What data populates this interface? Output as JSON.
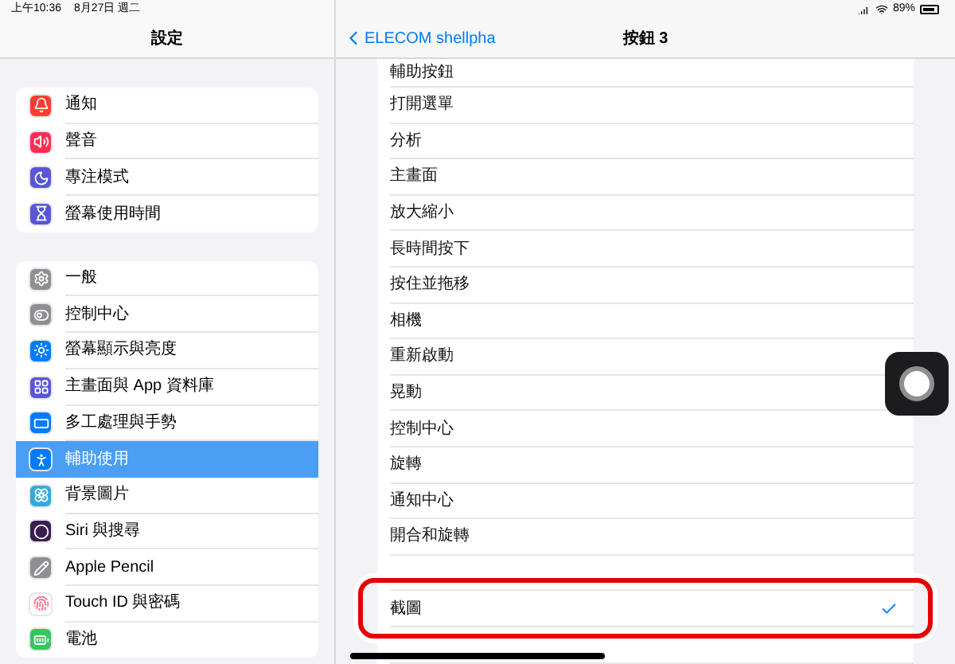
{
  "status_bar": {
    "time": "上午10:36",
    "date": "8月27日 週二",
    "battery": "89%"
  },
  "sidebar": {
    "title": "設定",
    "groups": [
      [
        {
          "label": "通知",
          "color": "#ff3b30",
          "selected": false
        },
        {
          "label": "聲音",
          "color": "#ff2d55",
          "selected": false
        },
        {
          "label": "專注模式",
          "color": "#5856d6",
          "selected": false
        },
        {
          "label": "螢幕使用時間",
          "color": "#5856d6",
          "selected": false
        }
      ],
      [
        {
          "label": "一般",
          "color": "#8e8e93",
          "selected": false
        },
        {
          "label": "控制中心",
          "color": "#8e8e93",
          "selected": false
        },
        {
          "label": "螢幕顯示與亮度",
          "color": "#007aff",
          "selected": false
        },
        {
          "label": "主畫面與 App 資料庫",
          "color": "#5856d6",
          "selected": false
        },
        {
          "label": "多工處理與手勢",
          "color": "#007aff",
          "selected": false
        },
        {
          "label": "輔助使用",
          "color": "#007aff",
          "selected": true
        },
        {
          "label": "背景圖片",
          "color": "#34aadc",
          "selected": false
        },
        {
          "label": "Siri 與搜尋",
          "color": "#3a1d4f",
          "selected": false
        },
        {
          "label": "Apple Pencil",
          "color": "#8e8e93",
          "selected": false
        },
        {
          "label": "Touch ID 與密碼",
          "color": "#ffffff",
          "selected": false
        },
        {
          "label": "電池",
          "color": "#34c759",
          "selected": false
        }
      ]
    ]
  },
  "detail": {
    "back": "ELECOM shellpha",
    "title": "按鈕 3",
    "items": [
      {
        "kind": "option",
        "label": "輔助按鈕",
        "selected": false,
        "highlighted": false
      },
      {
        "kind": "option",
        "label": "打開選單",
        "selected": false,
        "highlighted": false
      },
      {
        "kind": "option",
        "label": "分析",
        "selected": false,
        "highlighted": false
      },
      {
        "kind": "option",
        "label": "主畫面",
        "selected": false,
        "highlighted": false
      },
      {
        "kind": "option",
        "label": "放大縮小",
        "selected": false,
        "highlighted": false
      },
      {
        "kind": "option",
        "label": "長時間按下",
        "selected": false,
        "highlighted": false
      },
      {
        "kind": "option",
        "label": "按住並拖移",
        "selected": false,
        "highlighted": false
      },
      {
        "kind": "option",
        "label": "相機",
        "selected": false,
        "highlighted": false
      },
      {
        "kind": "option",
        "label": "重新啟動",
        "selected": false,
        "highlighted": false
      },
      {
        "kind": "option",
        "label": "晃動",
        "selected": false,
        "highlighted": false
      },
      {
        "kind": "option",
        "label": "控制中心",
        "selected": false,
        "highlighted": false
      },
      {
        "kind": "option",
        "label": "旋轉",
        "selected": false,
        "highlighted": false
      },
      {
        "kind": "option",
        "label": "通知中心",
        "selected": false,
        "highlighted": false
      },
      {
        "kind": "option",
        "label": "開合和旋轉",
        "selected": false,
        "highlighted": false
      },
      {
        "kind": "covered"
      },
      {
        "kind": "option",
        "label": "截圖",
        "selected": true,
        "highlighted": true
      },
      {
        "kind": "covered"
      }
    ]
  }
}
